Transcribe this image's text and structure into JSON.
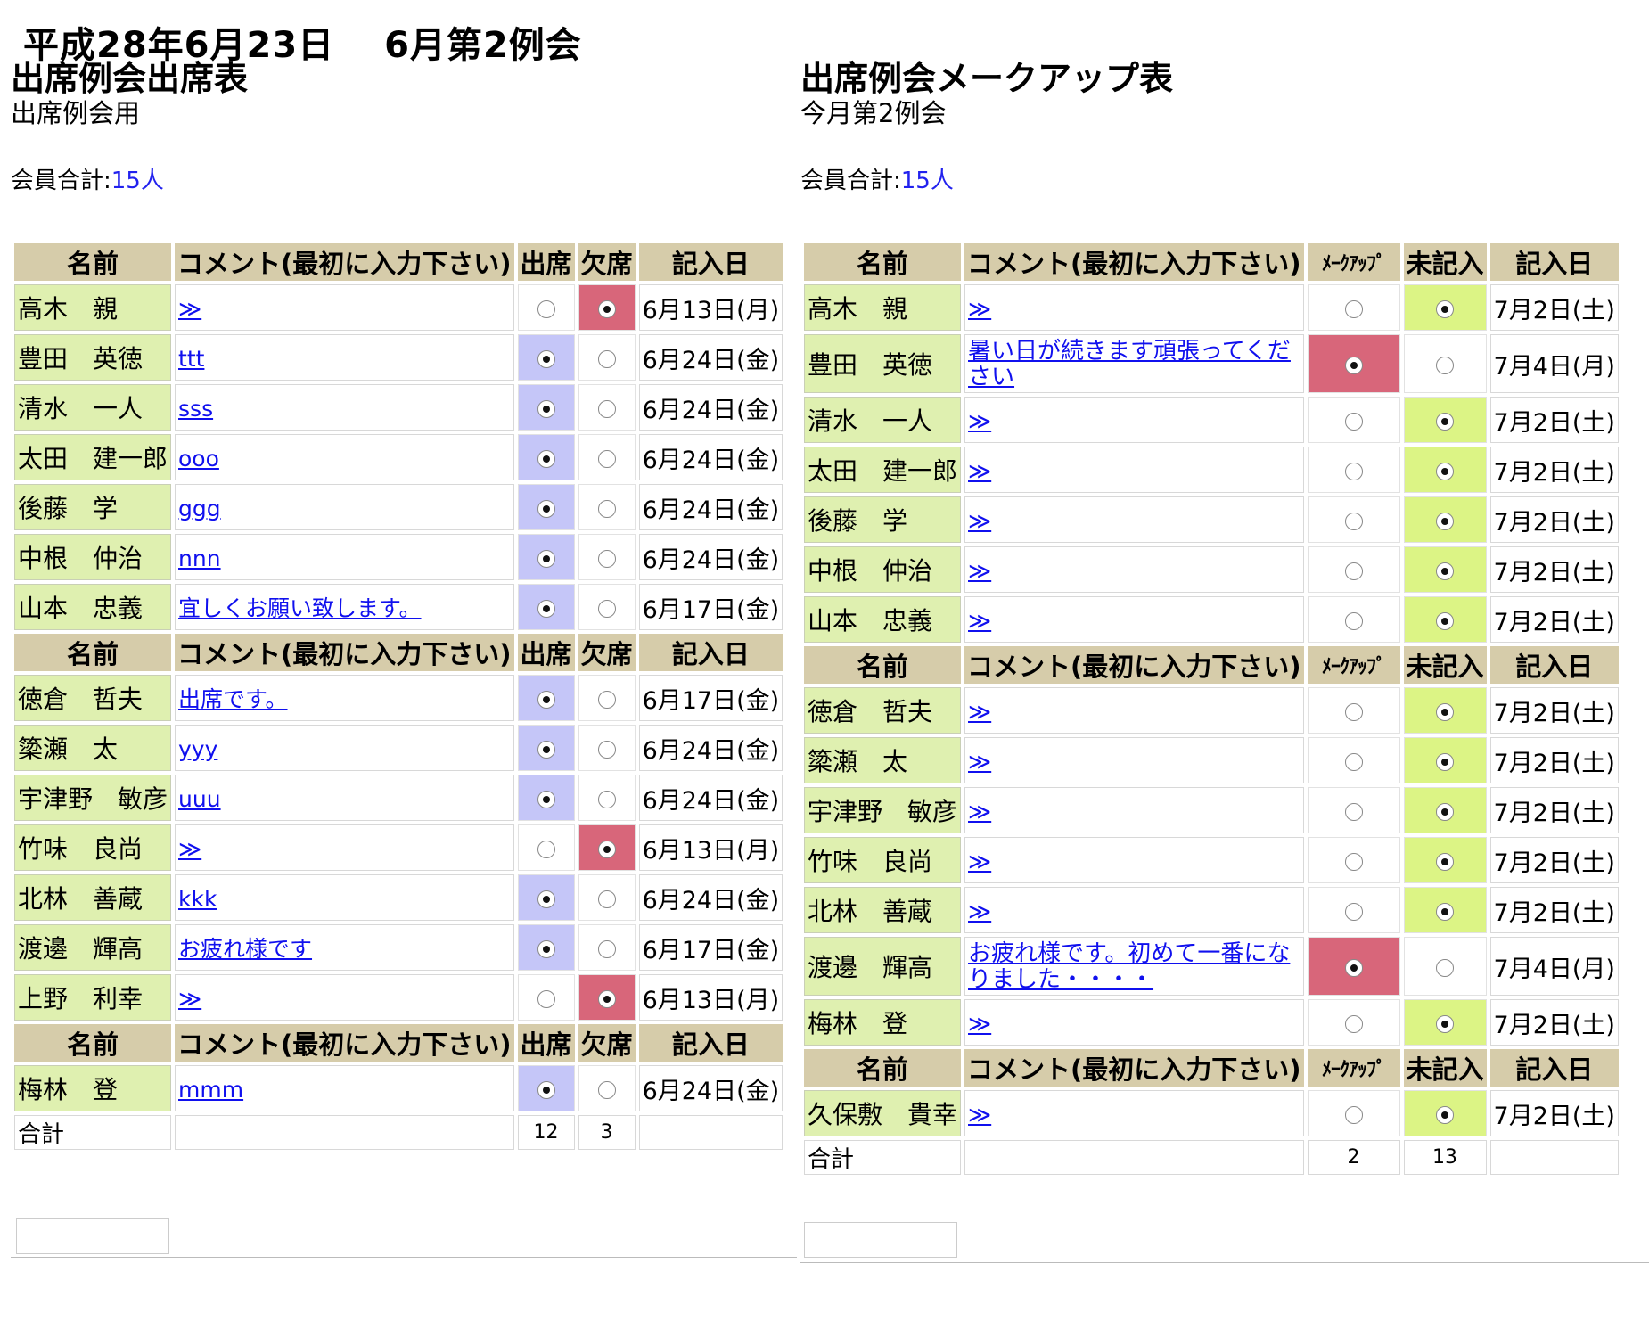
{
  "page": {
    "title": "平成28年6月23日　 6月第2例会"
  },
  "left": {
    "title": "出席例会出席表",
    "subtitle": "出席例会用",
    "count_label": "会員合計:",
    "count_value": "15人",
    "headers": [
      "名前",
      "コメント(最初に入力下さい)",
      "出席",
      "欠席",
      "記入日"
    ],
    "groups": [
      [
        {
          "name": "高木　親",
          "comment": "≫",
          "state": "absent",
          "date": "6月13日(月)"
        },
        {
          "name": "豊田　英徳",
          "comment": "ttt",
          "state": "present",
          "date": "6月24日(金)"
        },
        {
          "name": "清水　一人",
          "comment": "sss",
          "state": "present",
          "date": "6月24日(金)"
        },
        {
          "name": "太田　建一郎",
          "comment": "ooo",
          "state": "present",
          "date": "6月24日(金)"
        },
        {
          "name": "後藤　学",
          "comment": "ggg",
          "state": "present",
          "date": "6月24日(金)"
        },
        {
          "name": "中根　仲治",
          "comment": "nnn",
          "state": "present",
          "date": "6月24日(金)"
        },
        {
          "name": "山本　忠義",
          "comment": "宜しくお願い致します。",
          "state": "present",
          "date": "6月17日(金)"
        }
      ],
      [
        {
          "name": "徳倉　哲夫",
          "comment": "出席です。",
          "state": "present",
          "date": "6月17日(金)"
        },
        {
          "name": "簗瀬　太",
          "comment": "yyy",
          "state": "present",
          "date": "6月24日(金)"
        },
        {
          "name": "宇津野　敏彦",
          "comment": "uuu",
          "state": "present",
          "date": "6月24日(金)"
        },
        {
          "name": "竹味　良尚",
          "comment": "≫",
          "state": "absent",
          "date": "6月13日(月)"
        },
        {
          "name": "北林　善蔵",
          "comment": "kkk",
          "state": "present",
          "date": "6月24日(金)"
        },
        {
          "name": "渡邊　輝高",
          "comment": "お疲れ様です",
          "state": "present",
          "date": "6月17日(金)"
        },
        {
          "name": "上野　利幸",
          "comment": "≫",
          "state": "absent",
          "date": "6月13日(月)"
        }
      ],
      [
        {
          "name": "梅林　登",
          "comment": "mmm",
          "state": "present",
          "date": "6月24日(金)"
        }
      ]
    ],
    "total_label": "合計",
    "total_a": "12",
    "total_b": "3"
  },
  "right": {
    "title": "出席例会メークアップ表",
    "subtitle": "今月第2例会",
    "count_label": "会員合計:",
    "count_value": "15人",
    "headers": [
      "名前",
      "コメント(最初に入力下さい)",
      "ﾒｰｸｱｯﾌﾟ",
      "未記入",
      "記入日"
    ],
    "groups": [
      [
        {
          "name": "高木　親",
          "comment": "≫",
          "state": "unentered",
          "date": "7月2日(土)"
        },
        {
          "name": "豊田　英徳",
          "comment": "暑い日が続きます頑張ってください",
          "state": "makeup",
          "date": "7月4日(月)",
          "tall": true
        },
        {
          "name": "清水　一人",
          "comment": "≫",
          "state": "unentered",
          "date": "7月2日(土)"
        },
        {
          "name": "太田　建一郎",
          "comment": "≫",
          "state": "unentered",
          "date": "7月2日(土)"
        },
        {
          "name": "後藤　学",
          "comment": "≫",
          "state": "unentered",
          "date": "7月2日(土)"
        },
        {
          "name": "中根　仲治",
          "comment": "≫",
          "state": "unentered",
          "date": "7月2日(土)"
        },
        {
          "name": "山本　忠義",
          "comment": "≫",
          "state": "unentered",
          "date": "7月2日(土)"
        }
      ],
      [
        {
          "name": "徳倉　哲夫",
          "comment": "≫",
          "state": "unentered",
          "date": "7月2日(土)"
        },
        {
          "name": "簗瀬　太",
          "comment": "≫",
          "state": "unentered",
          "date": "7月2日(土)"
        },
        {
          "name": "宇津野　敏彦",
          "comment": "≫",
          "state": "unentered",
          "date": "7月2日(土)"
        },
        {
          "name": "竹味　良尚",
          "comment": "≫",
          "state": "unentered",
          "date": "7月2日(土)"
        },
        {
          "name": "北林　善蔵",
          "comment": "≫",
          "state": "unentered",
          "date": "7月2日(土)"
        },
        {
          "name": "渡邊　輝高",
          "comment": "お疲れ様です。初めて一番になりました・・・・",
          "state": "makeup",
          "date": "7月4日(月)",
          "tall": true
        },
        {
          "name": "梅林　登",
          "comment": "≫",
          "state": "unentered",
          "date": "7月2日(土)"
        }
      ],
      [
        {
          "name": "久保敷　貴幸",
          "comment": "≫",
          "state": "unentered",
          "date": "7月2日(土)"
        }
      ]
    ],
    "total_label": "合計",
    "total_a": "2",
    "total_b": "13"
  }
}
